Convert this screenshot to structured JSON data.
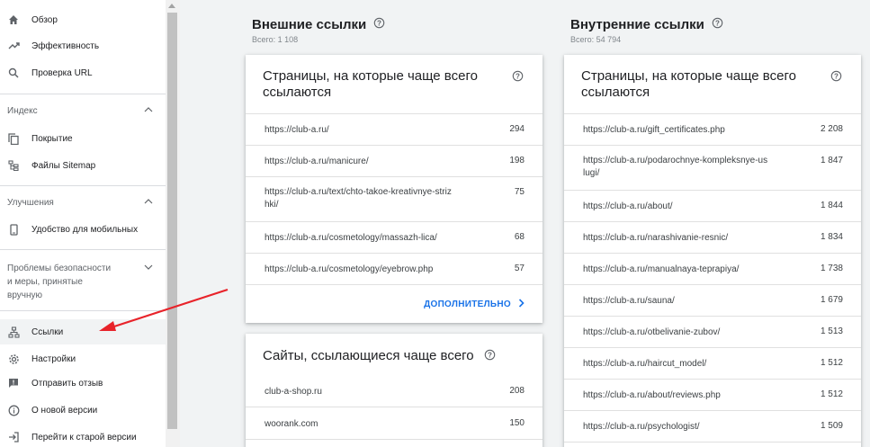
{
  "sidebar": {
    "top_items": [
      {
        "label": "Обзор",
        "icon": "home-icon"
      },
      {
        "label": "Эффективность",
        "icon": "trending-up-icon"
      },
      {
        "label": "Проверка URL",
        "icon": "search-icon"
      }
    ],
    "index_section": {
      "title": "Индекс",
      "items": [
        {
          "label": "Покрытие",
          "icon": "coverage-icon"
        },
        {
          "label": "Файлы Sitemap",
          "icon": "sitemap-icon"
        }
      ]
    },
    "enhancements_section": {
      "title": "Улучшения",
      "items": [
        {
          "label": "Удобство для мобильных",
          "icon": "mobile-icon"
        }
      ]
    },
    "security_section": {
      "title_lines": [
        "Проблемы безопасности",
        "и меры, принятые",
        "вручную"
      ]
    },
    "bottom_items": [
      {
        "label": "Ссылки",
        "icon": "links-icon",
        "active": true
      },
      {
        "label": "Настройки",
        "icon": "settings-icon"
      },
      {
        "label": "Отправить отзыв",
        "icon": "feedback-icon"
      },
      {
        "label": "О новой версии",
        "icon": "info-icon"
      },
      {
        "label": "Перейти к старой версии",
        "icon": "exit-icon"
      }
    ]
  },
  "external": {
    "title": "Внешние ссылки",
    "total": "Всего: 1 108",
    "top_pages_card": {
      "title_line1": "Страницы, на которые чаще всего",
      "title_line2": "ссылаются",
      "rows": [
        {
          "url": "https://club-a.ru/",
          "count": "294"
        },
        {
          "url": "https://club-a.ru/manicure/",
          "count": "198"
        },
        {
          "url_line1": "https://club-a.ru/text/chto-takoe-kreativnye-striz",
          "url_line2": "hki/",
          "count": "75"
        },
        {
          "url": "https://club-a.ru/cosmetology/massazh-lica/",
          "count": "68"
        },
        {
          "url": "https://club-a.ru/cosmetology/eyebrow.php",
          "count": "57"
        }
      ],
      "more_label": "ДОПОЛНИТЕЛЬНО"
    },
    "top_sites_card": {
      "title": "Сайты, ссылающиеся чаще всего",
      "rows": [
        {
          "url": "club-a-shop.ru",
          "count": "208"
        },
        {
          "url": "woorank.com",
          "count": "150"
        }
      ]
    }
  },
  "internal": {
    "title": "Внутренние ссылки",
    "total": "Всего: 54 794",
    "top_pages_card": {
      "title_line1": "Страницы, на которые чаще всего",
      "title_line2": "ссылаются",
      "rows": [
        {
          "url": "https://club-a.ru/gift_certificates.php",
          "count": "2 208"
        },
        {
          "url_line1": "https://club-a.ru/podarochnye-kompleksnye-us",
          "url_line2": "lugi/",
          "count": "1 847"
        },
        {
          "url": "https://club-a.ru/about/",
          "count": "1 844"
        },
        {
          "url": "https://club-a.ru/narashivanie-resnic/",
          "count": "1 834"
        },
        {
          "url": "https://club-a.ru/manualnaya-teprapiya/",
          "count": "1 738"
        },
        {
          "url": "https://club-a.ru/sauna/",
          "count": "1 679"
        },
        {
          "url": "https://club-a.ru/otbelivanie-zubov/",
          "count": "1 513"
        },
        {
          "url": "https://club-a.ru/haircut_model/",
          "count": "1 512"
        },
        {
          "url": "https://club-a.ru/about/reviews.php",
          "count": "1 512"
        },
        {
          "url": "https://club-a.ru/psychologist/",
          "count": "1 509"
        }
      ]
    }
  },
  "colors": {
    "accent": "#1a73e8",
    "annotation_arrow": "#e8232a"
  }
}
